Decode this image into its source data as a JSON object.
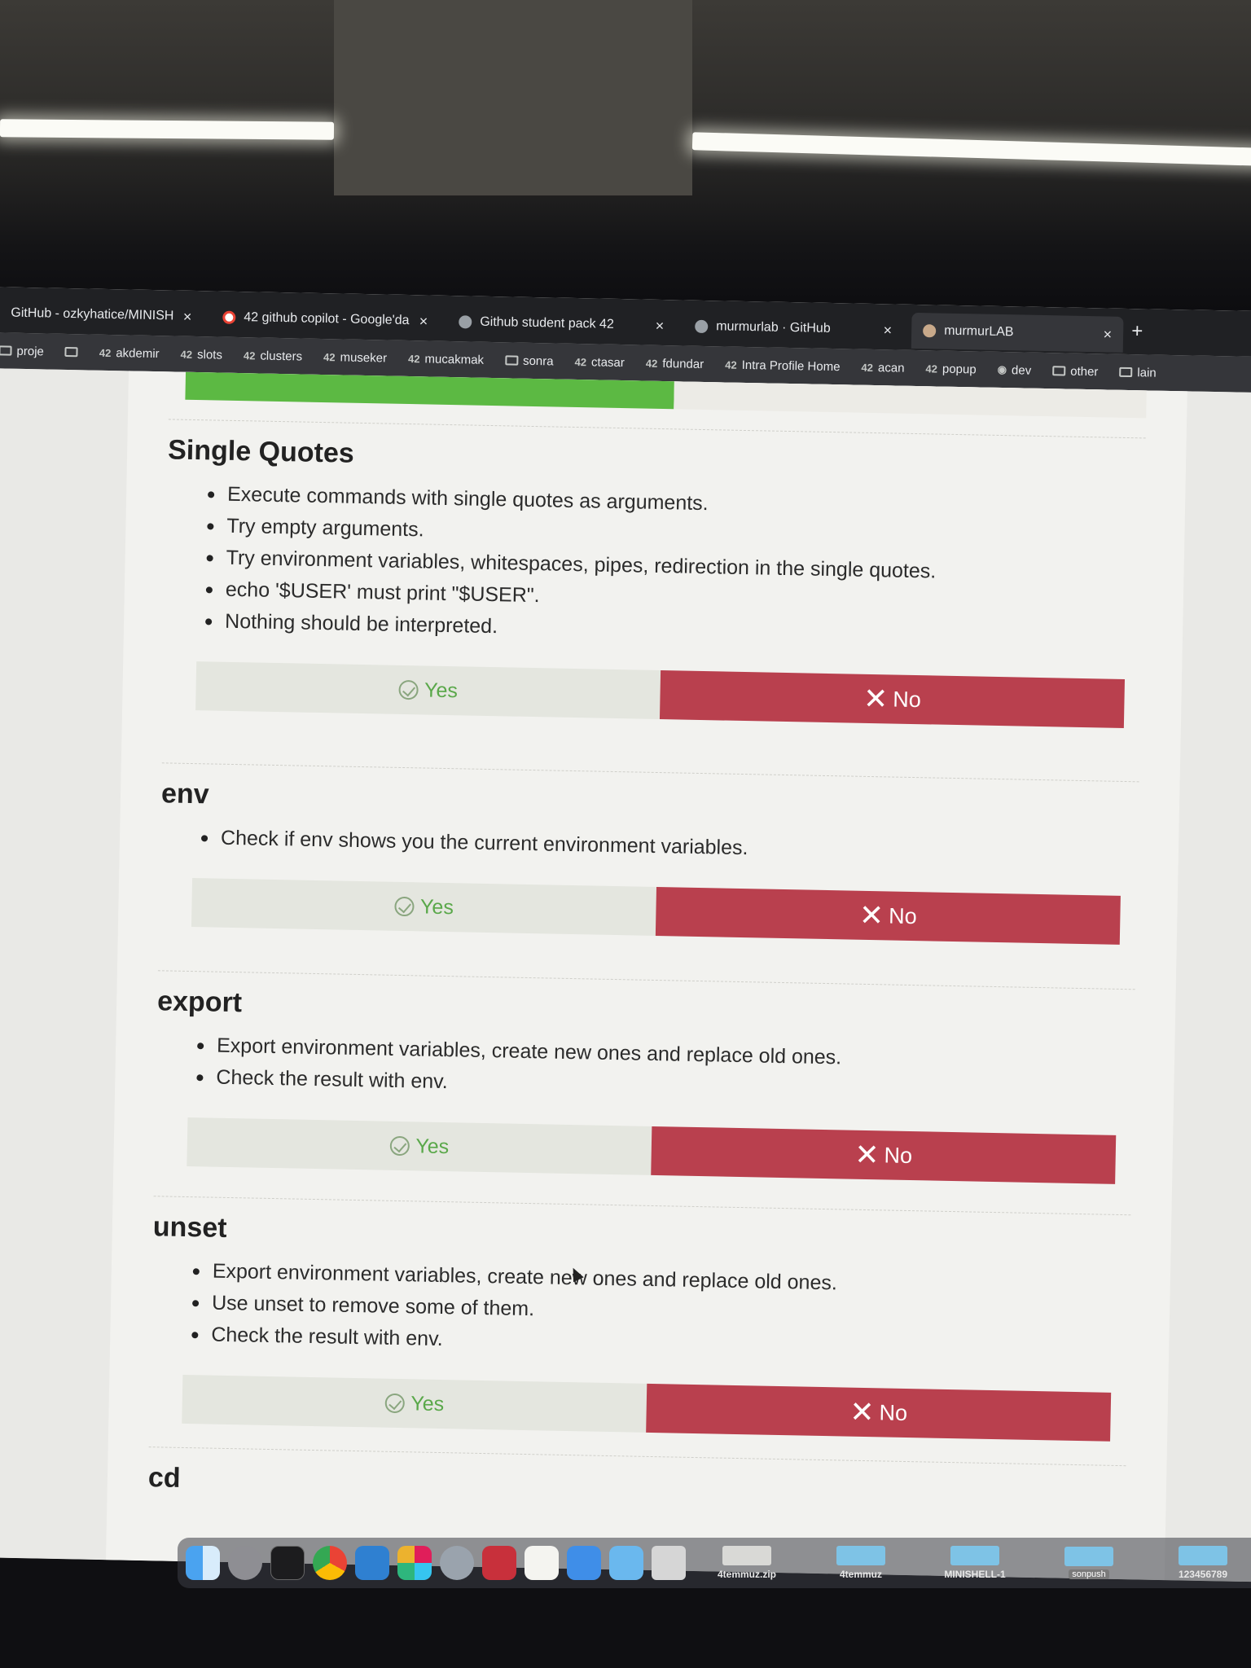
{
  "browser": {
    "tabs": [
      {
        "label": "GitHub - ozkyhatice/MINISHE",
        "favicon": "github-icon"
      },
      {
        "label": "42 github copilot - Google'da",
        "favicon": "google-icon"
      },
      {
        "label": "Github student pack 42",
        "favicon": "globe-icon"
      },
      {
        "label": "murmurlab · GitHub",
        "favicon": "github-icon"
      },
      {
        "label": "murmurLAB",
        "favicon": "avatar-icon"
      }
    ],
    "close_glyph": "×",
    "new_tab_glyph": "+",
    "bookmarks": [
      {
        "label": "proje",
        "icon": "folder"
      },
      {
        "label": "",
        "icon": "folder"
      },
      {
        "label": "akdemir",
        "icon": "42"
      },
      {
        "label": "slots",
        "icon": "42"
      },
      {
        "label": "clusters",
        "icon": "42"
      },
      {
        "label": "museker",
        "icon": "42"
      },
      {
        "label": "mucakmak",
        "icon": "42"
      },
      {
        "label": "sonra",
        "icon": "folder"
      },
      {
        "label": "ctasar",
        "icon": "42"
      },
      {
        "label": "fdundar",
        "icon": "42"
      },
      {
        "label": "Intra Profile Home",
        "icon": "42"
      },
      {
        "label": "acan",
        "icon": "42"
      },
      {
        "label": "popup",
        "icon": "42"
      },
      {
        "label": "dev",
        "icon": "github"
      },
      {
        "label": "other",
        "icon": "folder"
      },
      {
        "label": "lain",
        "icon": "folder"
      }
    ]
  },
  "sections": [
    {
      "title": "Single Quotes",
      "bullets": [
        "Execute commands with single quotes as arguments.",
        "Try empty arguments.",
        "Try environment variables, whitespaces, pipes, redirection in the single quotes.",
        "echo '$USER' must print \"$USER\".",
        "Nothing should be interpreted."
      ],
      "yes_label": "Yes",
      "no_label": "No"
    },
    {
      "title": "env",
      "bullets": [
        "Check if env shows you the current environment variables."
      ],
      "yes_label": "Yes",
      "no_label": "No"
    },
    {
      "title": "export",
      "bullets": [
        "Export environment variables, create new ones and replace old ones.",
        "Check the result with env."
      ],
      "yes_label": "Yes",
      "no_label": "No"
    },
    {
      "title": "unset",
      "bullets": [
        "Export environment variables, create new ones and replace old ones.",
        "Use unset to remove some of them.",
        "Check the result with env."
      ],
      "yes_label": "Yes",
      "no_label": "No"
    },
    {
      "title": "cd",
      "bullets": []
    }
  ],
  "dock": {
    "apps": [
      "finder-icon",
      "system-settings-icon",
      "terminal-icon",
      "chrome-icon",
      "vscode-icon",
      "slack-icon",
      "launchpad-icon",
      "photo-booth-icon",
      "textedit-icon",
      "xcode-icon",
      "folder-icon",
      "trash-icon"
    ],
    "files": [
      {
        "label": "4temmuz.zip",
        "type": "zip"
      },
      {
        "label": "4temmuz",
        "type": "folder"
      },
      {
        "label": "MINISHELL-1",
        "type": "folder"
      },
      {
        "label": "",
        "tag": "sonpush",
        "type": "folder"
      },
      {
        "label": "123456789",
        "type": "folder"
      }
    ]
  },
  "colors": {
    "yes_active": "#5cb943",
    "yes_text": "#5aa84a",
    "no_background": "#b9404e",
    "tabbar": "#202124",
    "bookmark_bar": "#35363a"
  }
}
